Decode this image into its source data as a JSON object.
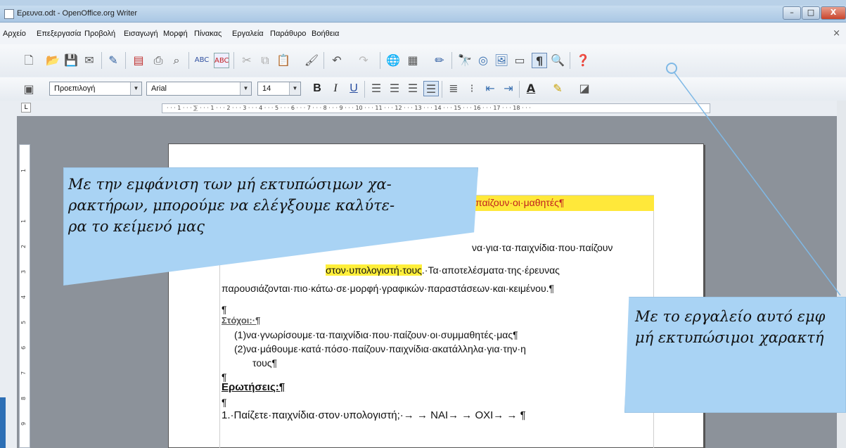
{
  "window": {
    "title": "Ερευνα.odt - OpenOffice.org Writer",
    "minimize": "–",
    "maximize": "□",
    "close": "X"
  },
  "menu": {
    "items": [
      "Αρχείο",
      "Επεξεργασία",
      "Προβολή",
      "Εισαγωγή",
      "Μορφή",
      "Πίνακας",
      "Εργαλεία",
      "Παράθυρο",
      "Βοήθεια"
    ],
    "close": "×"
  },
  "format_toolbar": {
    "style": "Προεπιλογή",
    "font": "Arial",
    "size": "14",
    "bold": "B",
    "italic": "I",
    "underline": "U"
  },
  "ruler": {
    "text": "· · · 1 · · · ⅀ · · · 1 · · · 2 · · · 3 · · · 4 · · · 5 · · · 6 · · · 7 · · · 8 · · · 9 · · · 10 · · · 11 · · · 12 · · · 13 · · · 14 · · · 15 · · · 16 · · · 17 · · · 18 · · ·",
    "tab_selector": "L"
  },
  "vertical_ruler": [
    "1",
    "1",
    "2",
    "3",
    "4",
    "5",
    "6",
    "7",
    "8",
    "9"
  ],
  "document": {
    "line1": "παίζουν·οι·μαθητές¶",
    "line2": "να·για·τα·παιχνίδια·που·παίζουν",
    "line3a": "στον·υπολογιστή·τους",
    "line3b": ".·Τα·αποτελέσματα·της·έρευνας",
    "line4": "παρουσιάζονται·πιο·κάτω·σε·μορφή·γραφικών·παραστάσεων·και·κειμένου.¶",
    "line5": "¶",
    "line6": "Στόχοι:·¶",
    "line7": "(1)να·γνωρίσουμε·τα·παιχνίδια·που·παίζουν·οι·συμμαθητές·μας¶",
    "line8": "(2)να·μάθουμε·κατά·πόσο·παίζουν·παιχνίδια·ακατάλληλα·για·την·η",
    "line9": "τους¶",
    "line10": "¶",
    "line11": "Ερωτήσεις:¶",
    "line12": "¶",
    "line13": "1.·Παίζετε·παιχνίδια·στον·υπολογιστή;·→   →   ΝΑΙ→   →   ΟΧΙ→   →   ¶"
  },
  "callouts": {
    "left": [
      "Με την εμφάνιση των μή εκτυπώσιμων χα-",
      "ρακτήρων, μπορούμε να ελέγξουμε καλύτε-",
      "ρα το κείμενό μας"
    ],
    "right": [
      "Με το εργαλείο αυτό εμφ",
      "μή εκτυπώσιμοι χαρακτή"
    ]
  },
  "colors": {
    "highlight": "#ffe83a",
    "callout": "#a9d3f4"
  }
}
